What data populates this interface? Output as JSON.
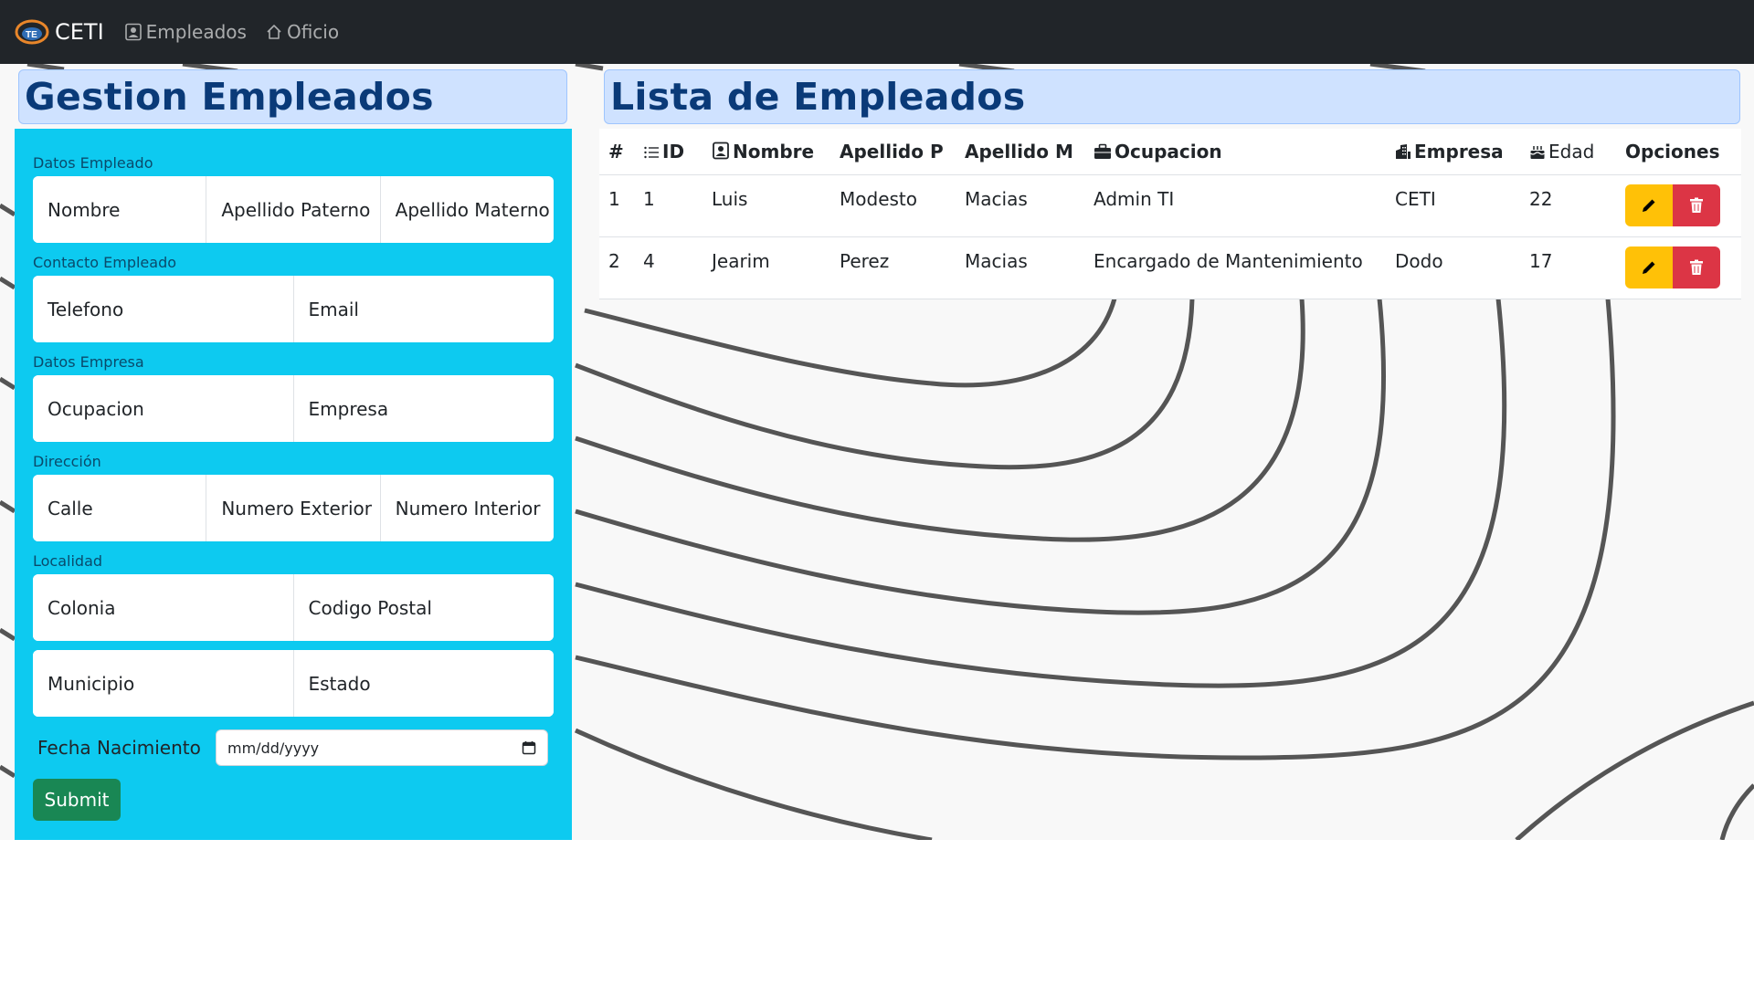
{
  "navbar": {
    "brand": "CETI",
    "links": [
      {
        "label": "Empleados",
        "icon": "person-badge-icon"
      },
      {
        "label": "Oficio",
        "icon": "house-icon"
      }
    ]
  },
  "form": {
    "title": "Gestion Empleados",
    "sections": {
      "datos_empleado": "Datos Empleado",
      "contacto_empleado": "Contacto Empleado",
      "datos_empresa": "Datos Empresa",
      "direccion": "Dirección",
      "localidad": "Localidad"
    },
    "placeholders": {
      "nombre": "Nombre",
      "apellido_paterno": "Apellido Paterno",
      "apellido_materno": "Apellido Materno",
      "telefono": "Telefono",
      "email": "Email",
      "ocupacion": "Ocupacion",
      "empresa": "Empresa",
      "calle": "Calle",
      "numero_exterior": "Numero Exterior",
      "numero_interior": "Numero Interior",
      "colonia": "Colonia",
      "codigo_postal": "Codigo Postal",
      "municipio": "Municipio",
      "estado": "Estado"
    },
    "fecha_label": "Fecha Nacimiento",
    "fecha_placeholder": "mm/dd/yyyy",
    "submit": "Submit"
  },
  "list": {
    "title": "Lista de Empleados",
    "headers": {
      "num": "#",
      "id": "ID",
      "nombre": "Nombre",
      "apellido_p": "Apellido P",
      "apellido_m": "Apellido M",
      "ocupacion": "Ocupacion",
      "empresa": "Empresa",
      "edad": "Edad",
      "opciones": "Opciones"
    },
    "rows": [
      {
        "num": "1",
        "id": "1",
        "nombre": "Luis",
        "apellido_p": "Modesto",
        "apellido_m": "Macias",
        "ocupacion": "Admin TI",
        "empresa": "CETI",
        "edad": "22"
      },
      {
        "num": "2",
        "id": "4",
        "nombre": "Jearim",
        "apellido_p": "Perez",
        "apellido_m": "Macias",
        "ocupacion": "Encargado de Mantenimiento",
        "empresa": "Dodo",
        "edad": "17"
      }
    ]
  },
  "colors": {
    "navbar": "#212529",
    "form_panel": "#0dcaf0",
    "title_bg": "#cfe2ff",
    "title_text": "#0a3a78",
    "submit": "#198754",
    "edit": "#ffc107",
    "delete": "#dc3545"
  }
}
